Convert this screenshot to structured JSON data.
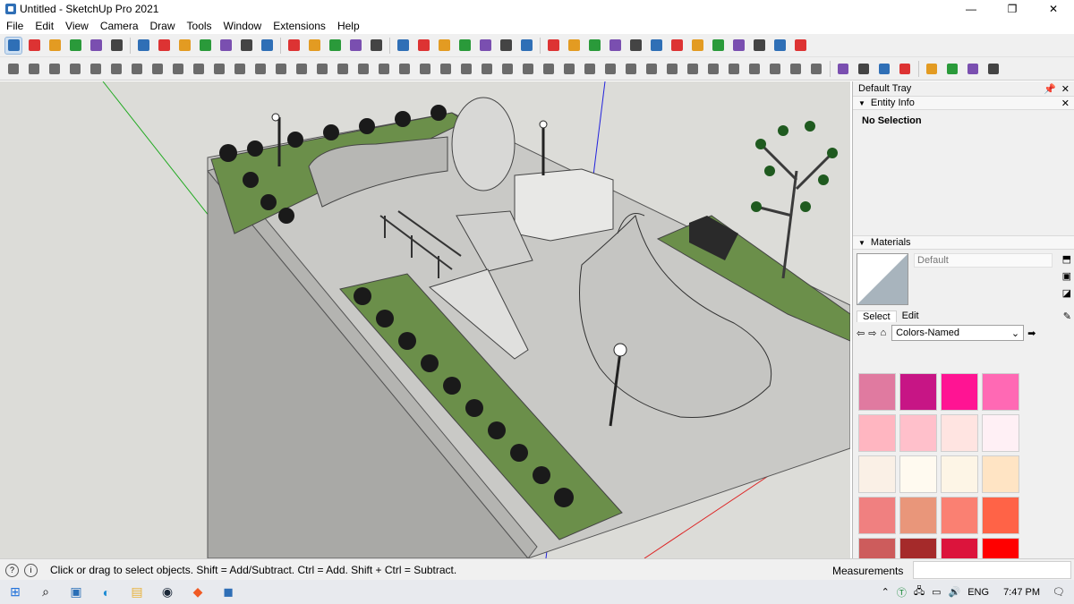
{
  "window": {
    "title": "Untitled - SketchUp Pro 2021",
    "minimize": "—",
    "maximize": "❐",
    "close": "✕"
  },
  "menu": [
    "File",
    "Edit",
    "View",
    "Camera",
    "Draw",
    "Tools",
    "Window",
    "Extensions",
    "Help"
  ],
  "toolbar1_icons": [
    "select-tool",
    "eraser-tool",
    "line-tool",
    "arc-tool",
    "rectangle-tool",
    "push-pull-tool",
    "follow-me-tool",
    "move-tool",
    "rotate-tool",
    "scale-tool",
    "tape-measure-tool",
    "text-tool",
    "paint-bucket-tool",
    "orbit-tool",
    "pan-tool",
    "zoom-tool",
    "zoom-extents-tool",
    "section-plane-tool",
    "warehouse-tool",
    "extension-tool",
    "styles-tool",
    "layers-tool",
    "account-tool",
    "sandbox-tool",
    "refresh-tool",
    "layout-tool",
    "add-location-tool",
    "tree-tool",
    "render-tool",
    "checker-tool",
    "cloud-tool",
    "settings-tool",
    "email-tool",
    "info-tool",
    "book-tool",
    "book-2-tool",
    "book-3-tool",
    "cube-tool"
  ],
  "toolbar2_icon_count": 48,
  "tray": {
    "title": "Default Tray",
    "entity_info": {
      "title": "Entity Info",
      "body": "No Selection"
    },
    "materials": {
      "title": "Materials",
      "current_name": "Default",
      "tabs": {
        "select": "Select",
        "edit": "Edit"
      },
      "library": "Colors-Named",
      "swatches": [
        "#e07aa0",
        "#c71585",
        "#ff1493",
        "#ff69b4",
        "#ffb6c1",
        "#ffc0cb",
        "#ffe4e1",
        "#fff0f5",
        "#faf0e6",
        "#fffaf0",
        "#fdf5e6",
        "#ffe4c4",
        "#f08080",
        "#e9967a",
        "#fa8072",
        "#ff6347",
        "#cd5c5c",
        "#a52a2a",
        "#dc143c",
        "#ff0000"
      ]
    }
  },
  "status": {
    "message": "Click or drag to select objects. Shift = Add/Subtract. Ctrl = Add. Shift + Ctrl = Subtract.",
    "measurements_label": "Measurements"
  },
  "taskbar": {
    "icons": [
      "windows-start-icon",
      "search-icon",
      "photos-icon",
      "edge-icon",
      "file-explorer-icon",
      "steam-icon",
      "brave-icon",
      "sketchup-taskbar-icon"
    ],
    "language": "ENG",
    "time": "7:47 PM"
  },
  "colors": {
    "accent": "#2f6fb6",
    "axis_red": "#d22",
    "axis_green": "#2a2",
    "axis_blue": "#22d"
  }
}
